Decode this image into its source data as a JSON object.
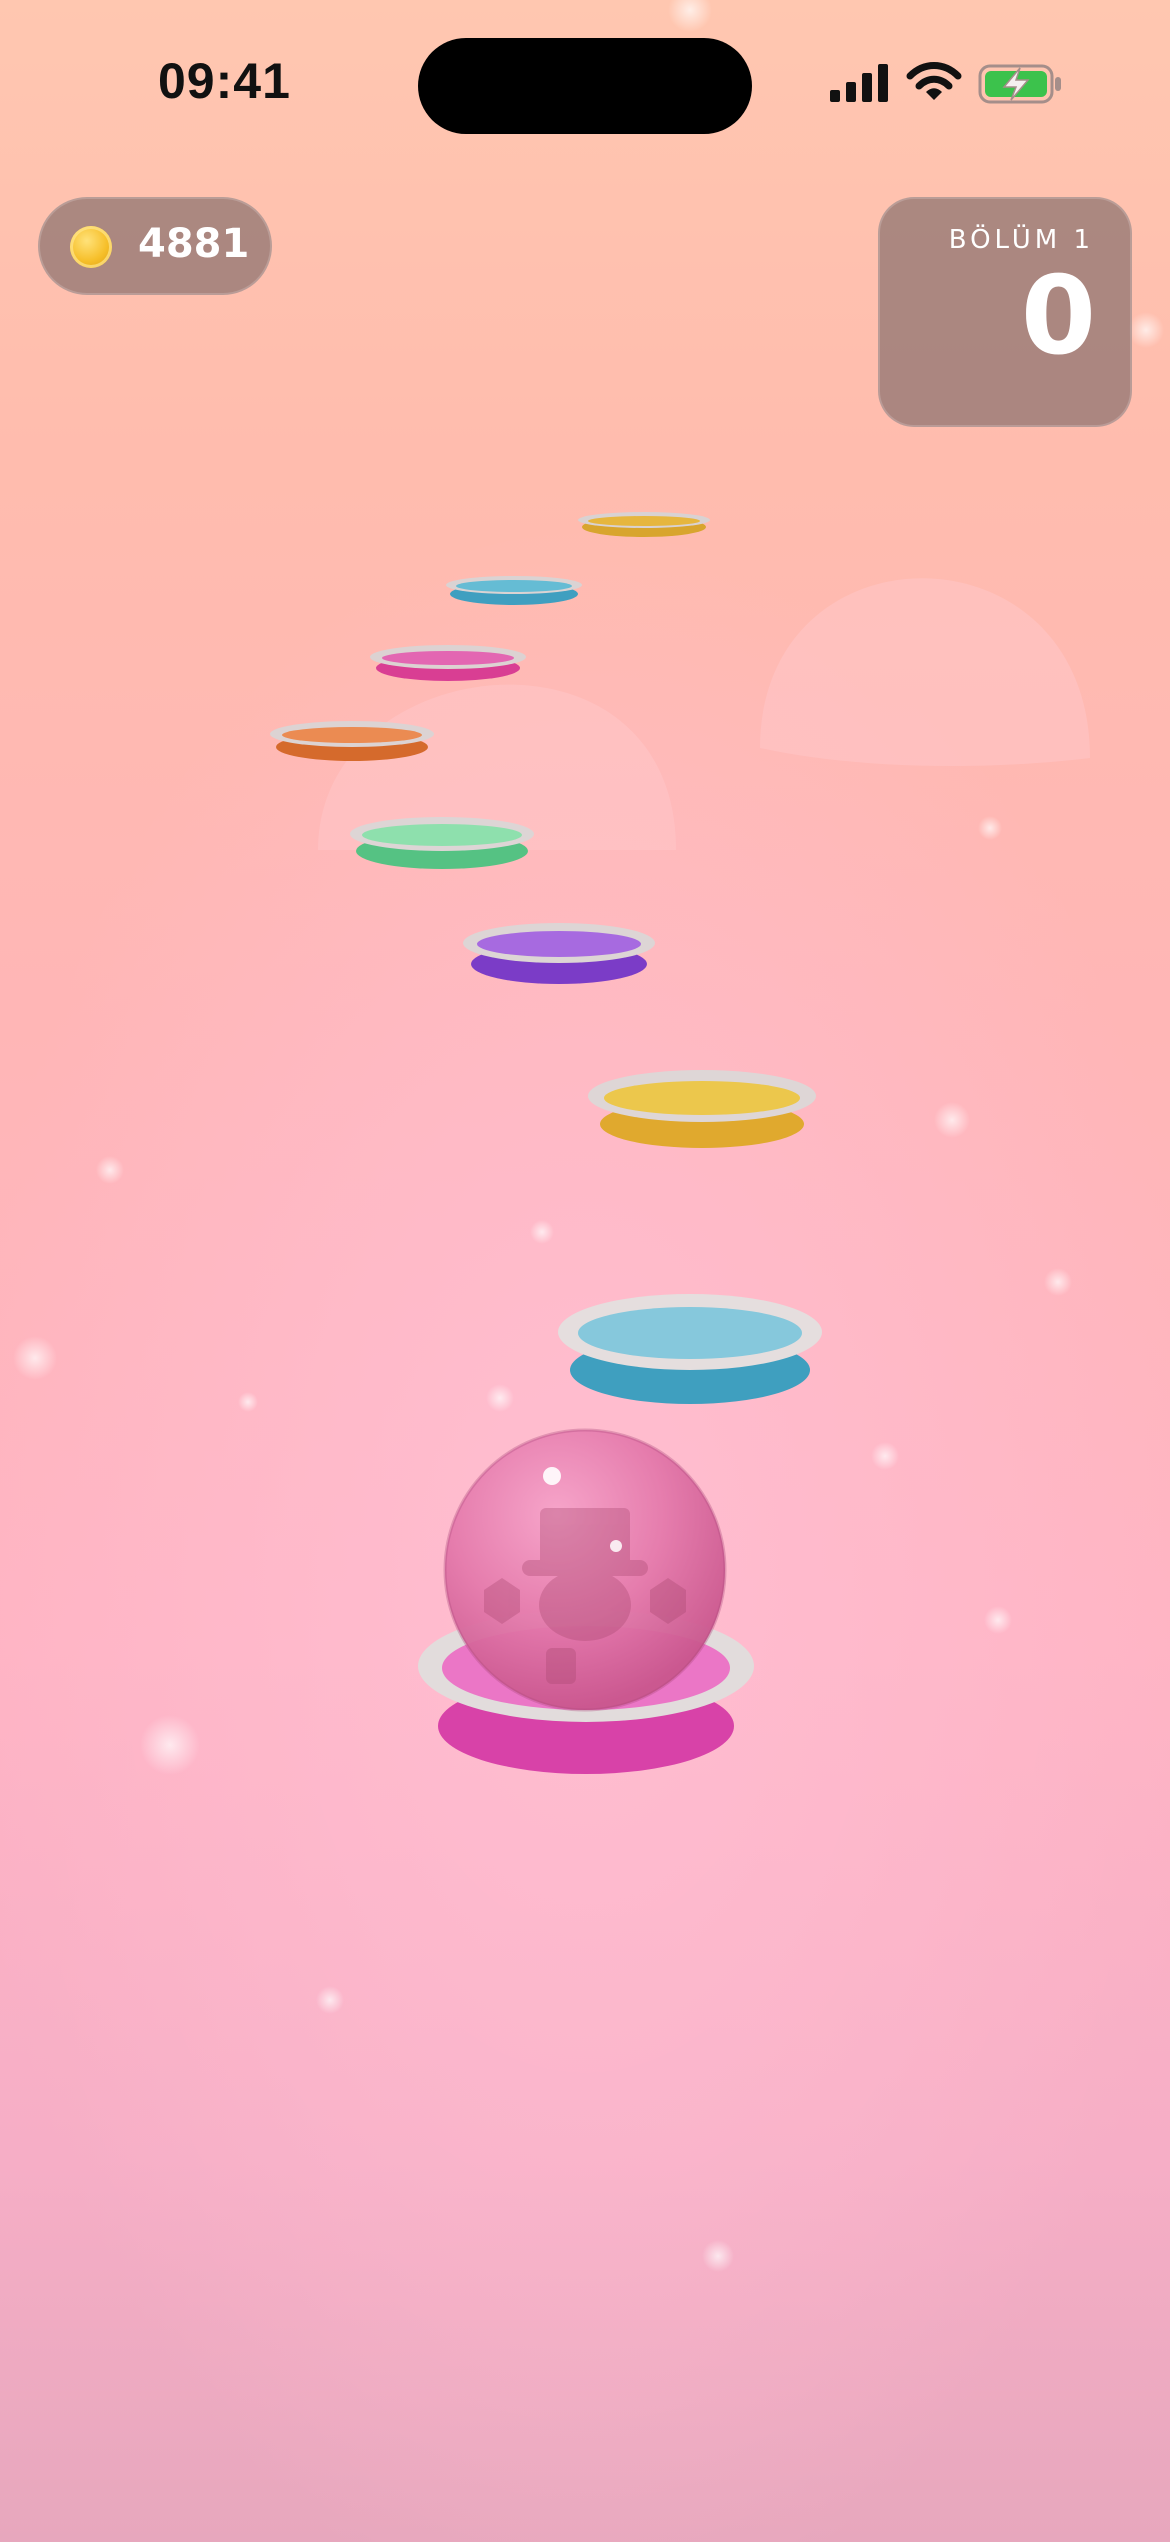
{
  "status_bar": {
    "time": "09:41",
    "icons": [
      "signal-icon",
      "wifi-icon",
      "charging-battery-icon"
    ]
  },
  "hud": {
    "coins": "4881",
    "coin_icon": "gold-coin-icon",
    "level_label": "BÖLÜM 1",
    "score": "0"
  },
  "game": {
    "player": "pink-bubble-ball-with-character",
    "platforms": [
      {
        "color": "#e24fb0",
        "name": "magenta"
      },
      {
        "color": "#57b8cf",
        "name": "blue"
      },
      {
        "color": "#e8c23c",
        "name": "yellow"
      },
      {
        "color": "#8e4fd8",
        "name": "purple"
      },
      {
        "color": "#6fd39a",
        "name": "green"
      },
      {
        "color": "#e77b3d",
        "name": "orange"
      },
      {
        "color": "#e0509f",
        "name": "pink"
      },
      {
        "color": "#55b2d0",
        "name": "blue"
      },
      {
        "color": "#e2b33a",
        "name": "yellow"
      }
    ]
  },
  "colors": {
    "sky_top": "#ffc7b0",
    "sky_bottom": "#e7a7bd",
    "hud_bg": "#7a6464"
  }
}
